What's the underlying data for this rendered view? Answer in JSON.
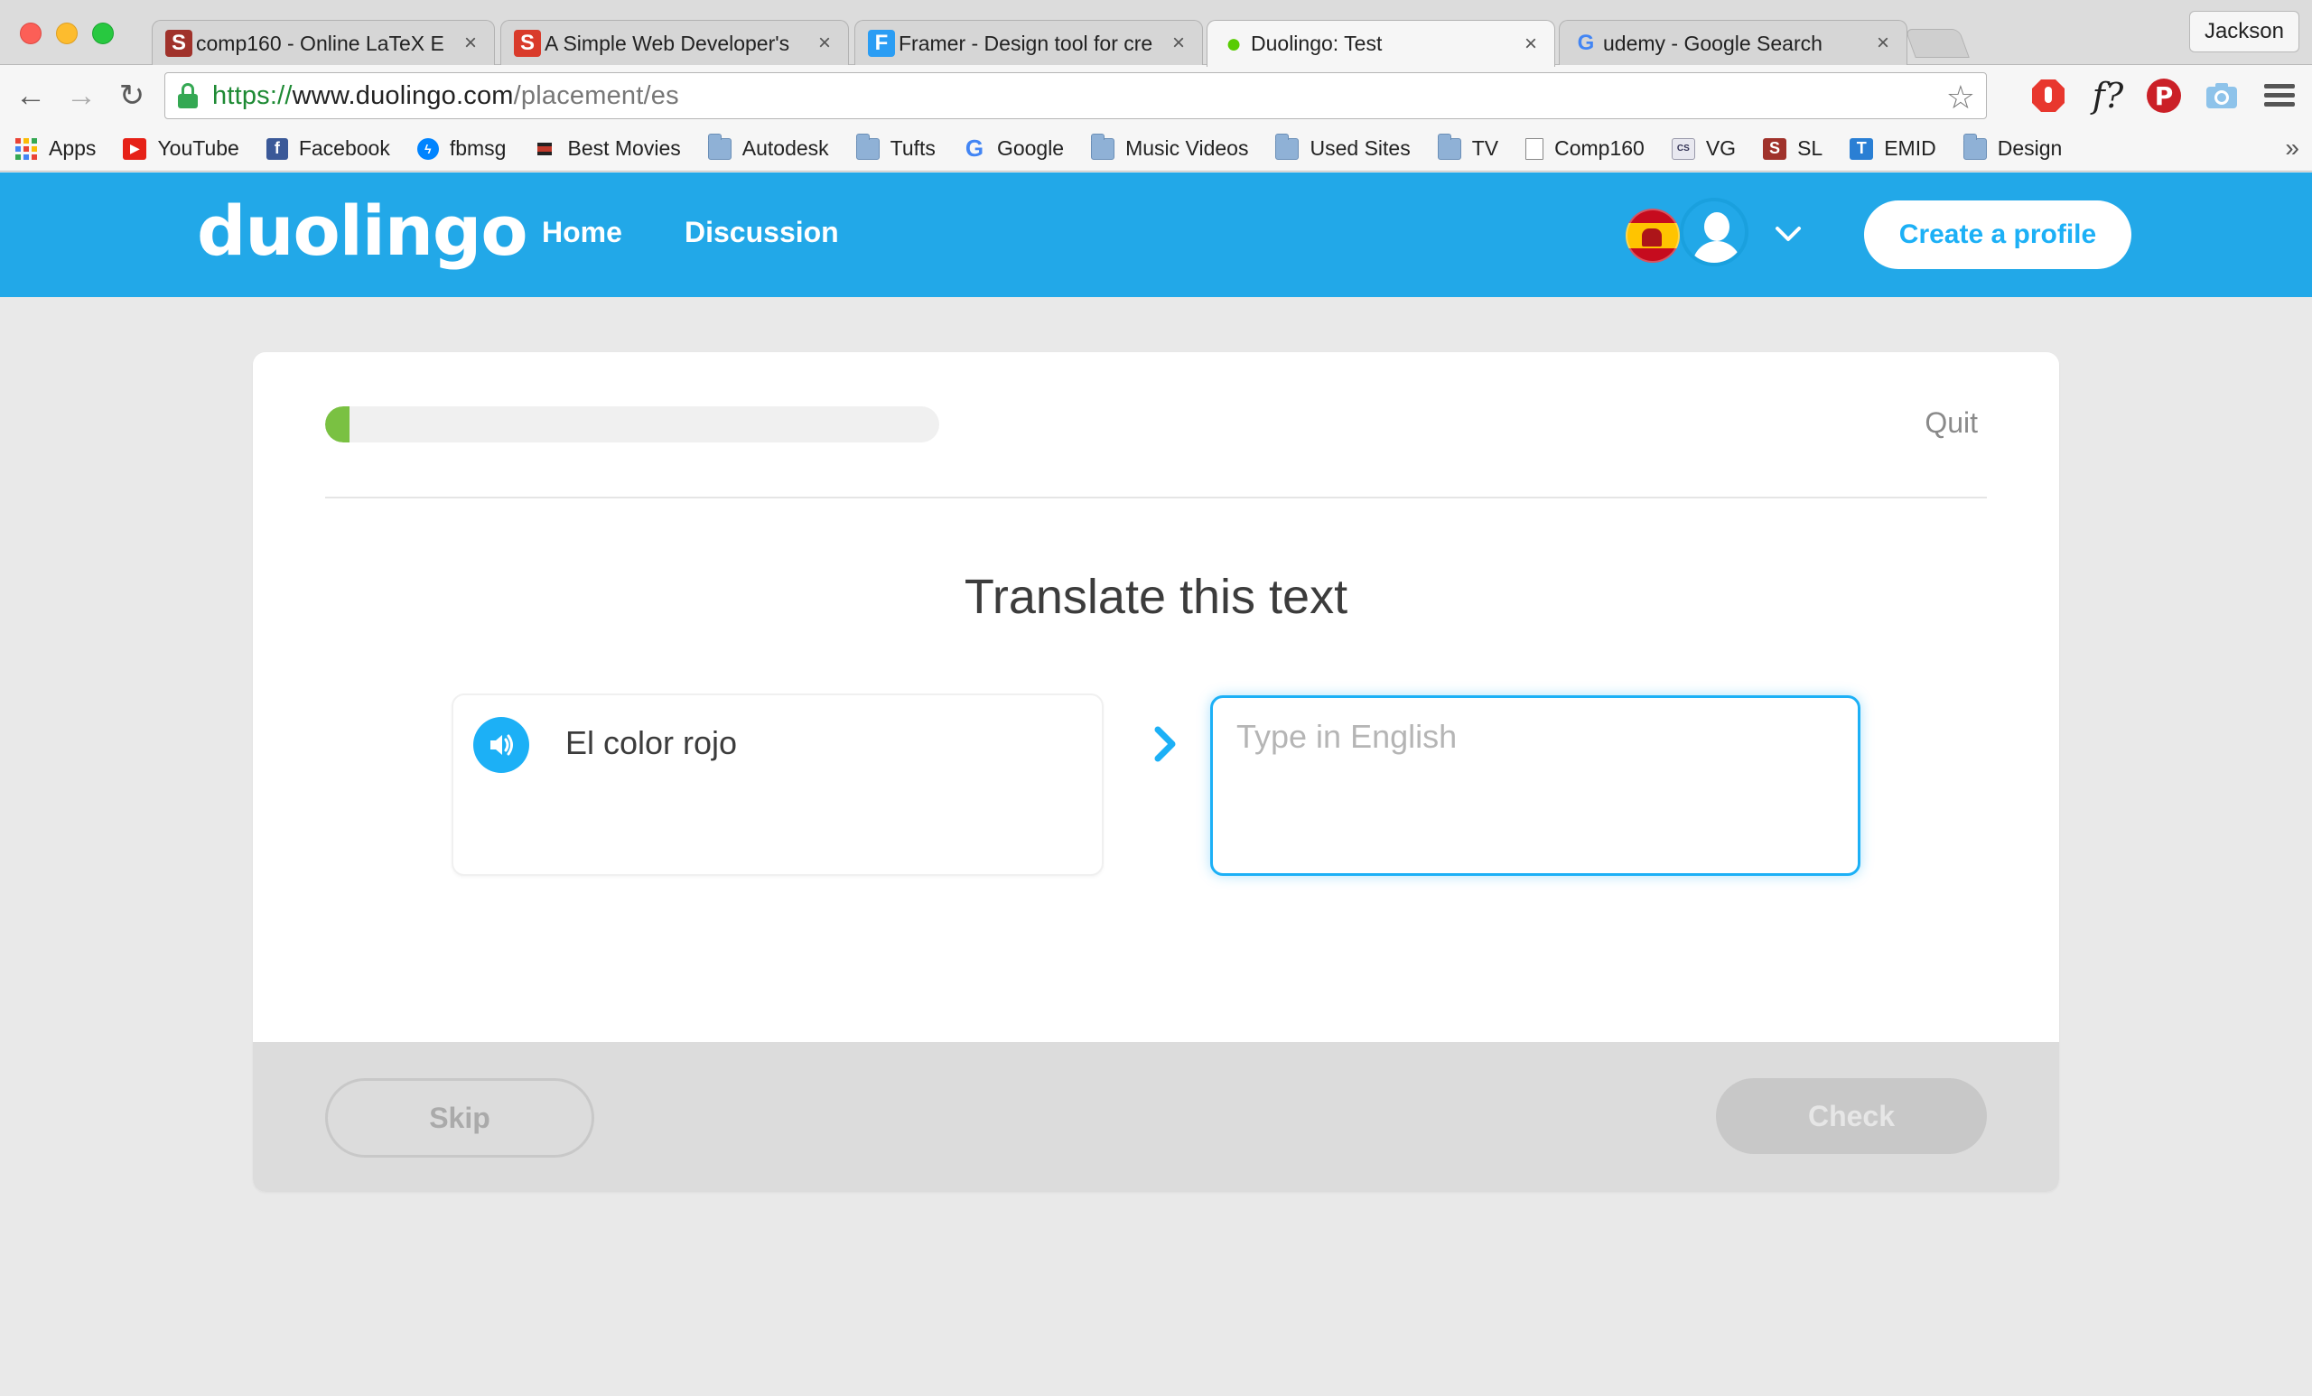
{
  "browser": {
    "profile_name": "Jackson",
    "tabs": [
      {
        "title": "comp160 - Online LaTeX E",
        "icon": "sharelatex-icon",
        "color": "#a0322b",
        "glyph": "S"
      },
      {
        "title": "A Simple Web Developer's",
        "icon": "html-s-icon",
        "color": "#d93b2b",
        "glyph": "S"
      },
      {
        "title": "Framer - Design tool for cre",
        "icon": "framer-icon",
        "color": "#2a9df4",
        "glyph": "F"
      },
      {
        "title": "Duolingo: Test",
        "icon": "duolingo-owl-icon",
        "color": "#58cc02",
        "glyph": "●",
        "active": true
      },
      {
        "title": "udemy - Google Search",
        "icon": "google-g-icon",
        "color": "#4285f4",
        "glyph": "G"
      }
    ],
    "url": {
      "scheme": "https://",
      "host": "www.duolingo.com",
      "path": "/placement/es"
    },
    "bookmarks": [
      {
        "label": "Apps",
        "icon": "apps-grid-icon"
      },
      {
        "label": "YouTube",
        "icon": "youtube-icon"
      },
      {
        "label": "Facebook",
        "icon": "facebook-icon"
      },
      {
        "label": "fbmsg",
        "icon": "messenger-icon"
      },
      {
        "label": "Best Movies",
        "icon": "imdb-icon"
      },
      {
        "label": "Autodesk",
        "icon": "folder-icon"
      },
      {
        "label": "Tufts",
        "icon": "folder-icon"
      },
      {
        "label": "Google",
        "icon": "google-g-icon"
      },
      {
        "label": "Music Videos",
        "icon": "folder-icon"
      },
      {
        "label": "Used Sites",
        "icon": "folder-icon"
      },
      {
        "label": "TV",
        "icon": "folder-icon"
      },
      {
        "label": "Comp160",
        "icon": "page-icon"
      },
      {
        "label": "VG",
        "icon": "vg-icon"
      },
      {
        "label": "SL",
        "icon": "sharelatex-icon"
      },
      {
        "label": "EMID",
        "icon": "t-icon"
      },
      {
        "label": "Design",
        "icon": "folder-icon"
      }
    ],
    "more": "»"
  },
  "duo": {
    "logo": "duolingo",
    "nav": {
      "home": "Home",
      "discussion": "Discussion"
    },
    "create_profile": "Create a profile",
    "brand_color": "#1cb0f6"
  },
  "lesson": {
    "progress": 0.04,
    "quit": "Quit",
    "prompt": "Translate this text",
    "source_text": "El color rojo",
    "answer_placeholder": "Type in English",
    "answer_value": "",
    "skip": "Skip",
    "check": "Check"
  }
}
